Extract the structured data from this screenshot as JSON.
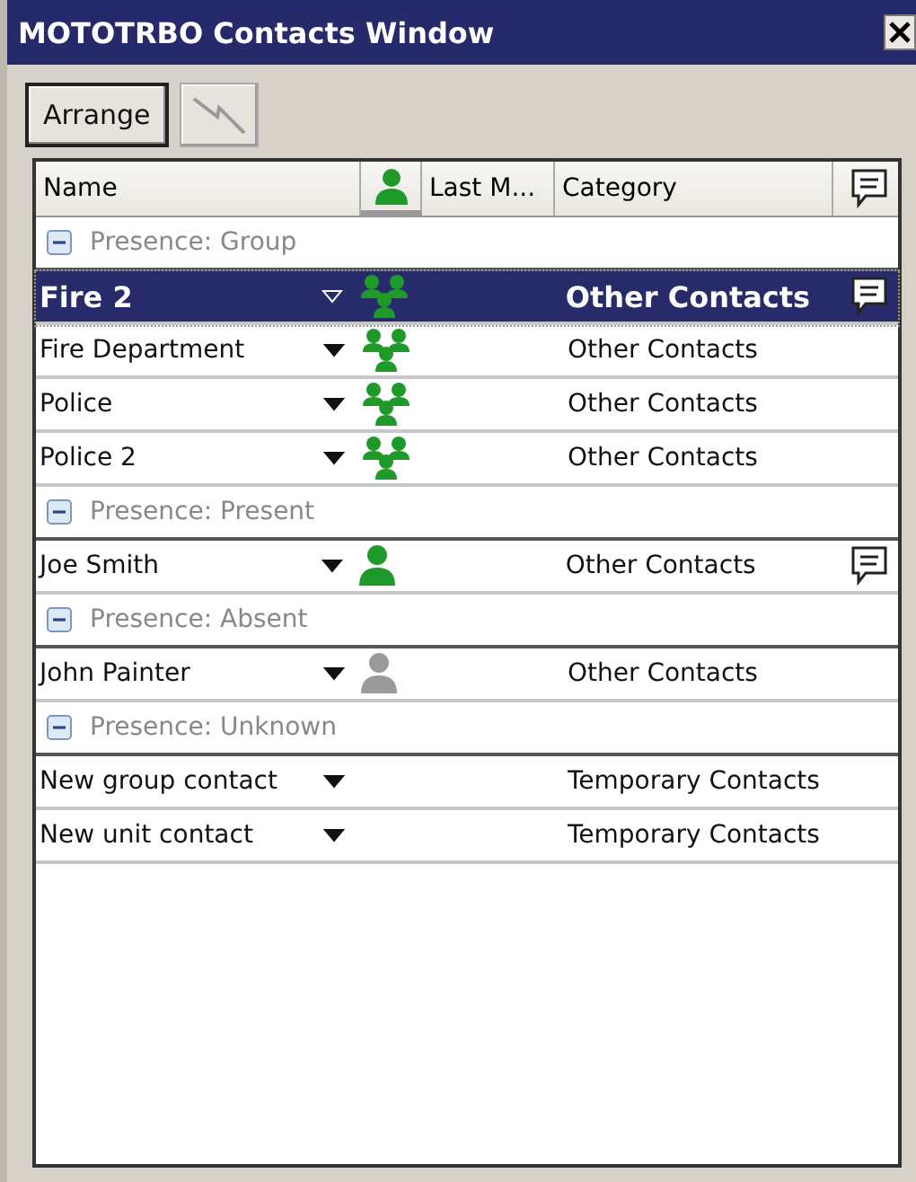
{
  "window": {
    "title": "MOTOTRBO Contacts Window"
  },
  "toolbar": [
    {
      "kind": "text",
      "label": "Arrange",
      "disabled": false
    },
    {
      "kind": "lightning",
      "disabled": true
    }
  ],
  "table": {
    "columns": [
      {
        "kind": "text",
        "label": "Name"
      },
      {
        "kind": "presence"
      },
      {
        "kind": "text",
        "label": "Last M..."
      },
      {
        "kind": "text",
        "label": "Category"
      },
      {
        "kind": "message"
      }
    ],
    "groups": [
      {
        "label": "Presence: Group",
        "expanded": true,
        "rows": [
          {
            "name": "Fire 2",
            "kind": "group",
            "category": "Other Contacts",
            "message": true,
            "selected": true
          },
          {
            "name": "Fire Department",
            "kind": "group",
            "category": "Other Contacts",
            "message": false,
            "selected": false
          },
          {
            "name": "Police",
            "kind": "group",
            "category": "Other Contacts",
            "message": false,
            "selected": false
          },
          {
            "name": "Police 2",
            "kind": "group",
            "category": "Other Contacts",
            "message": false,
            "selected": false
          }
        ]
      },
      {
        "label": "Presence: Present",
        "expanded": true,
        "rows": [
          {
            "name": "Joe Smith",
            "kind": "present",
            "category": "Other Contacts",
            "message": true,
            "selected": false
          }
        ]
      },
      {
        "label": "Presence: Absent",
        "expanded": true,
        "rows": [
          {
            "name": "John Painter",
            "kind": "absent",
            "category": "Other Contacts",
            "message": false,
            "selected": false
          }
        ]
      },
      {
        "label": "Presence: Unknown",
        "expanded": true,
        "rows": [
          {
            "name": "New group contact",
            "kind": "unknown",
            "category": "Temporary Contacts",
            "message": false,
            "selected": false
          },
          {
            "name": "New unit contact",
            "kind": "unknown",
            "category": "Temporary Contacts",
            "message": false,
            "selected": false
          }
        ]
      }
    ]
  }
}
